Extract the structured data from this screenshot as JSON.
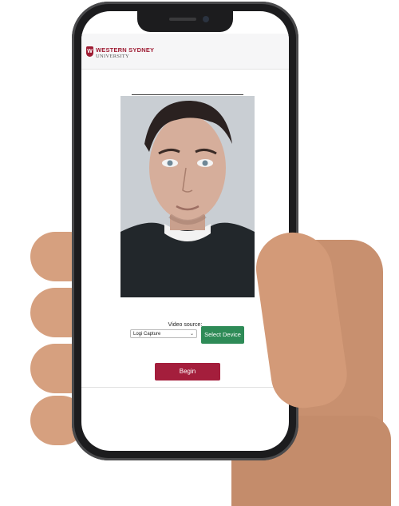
{
  "brand": {
    "line1": "WESTERN SYDNEY",
    "line2": "UNIVERSITY",
    "mark": "W",
    "color": "#9e1b32"
  },
  "video": {
    "source_label": "Video source:",
    "source_value": "Logi Capture",
    "chevron": "⌄"
  },
  "buttons": {
    "select_device": "Select Device",
    "select_device_color": "#2e8b57",
    "begin": "Begin",
    "begin_color": "#a41e3c"
  }
}
